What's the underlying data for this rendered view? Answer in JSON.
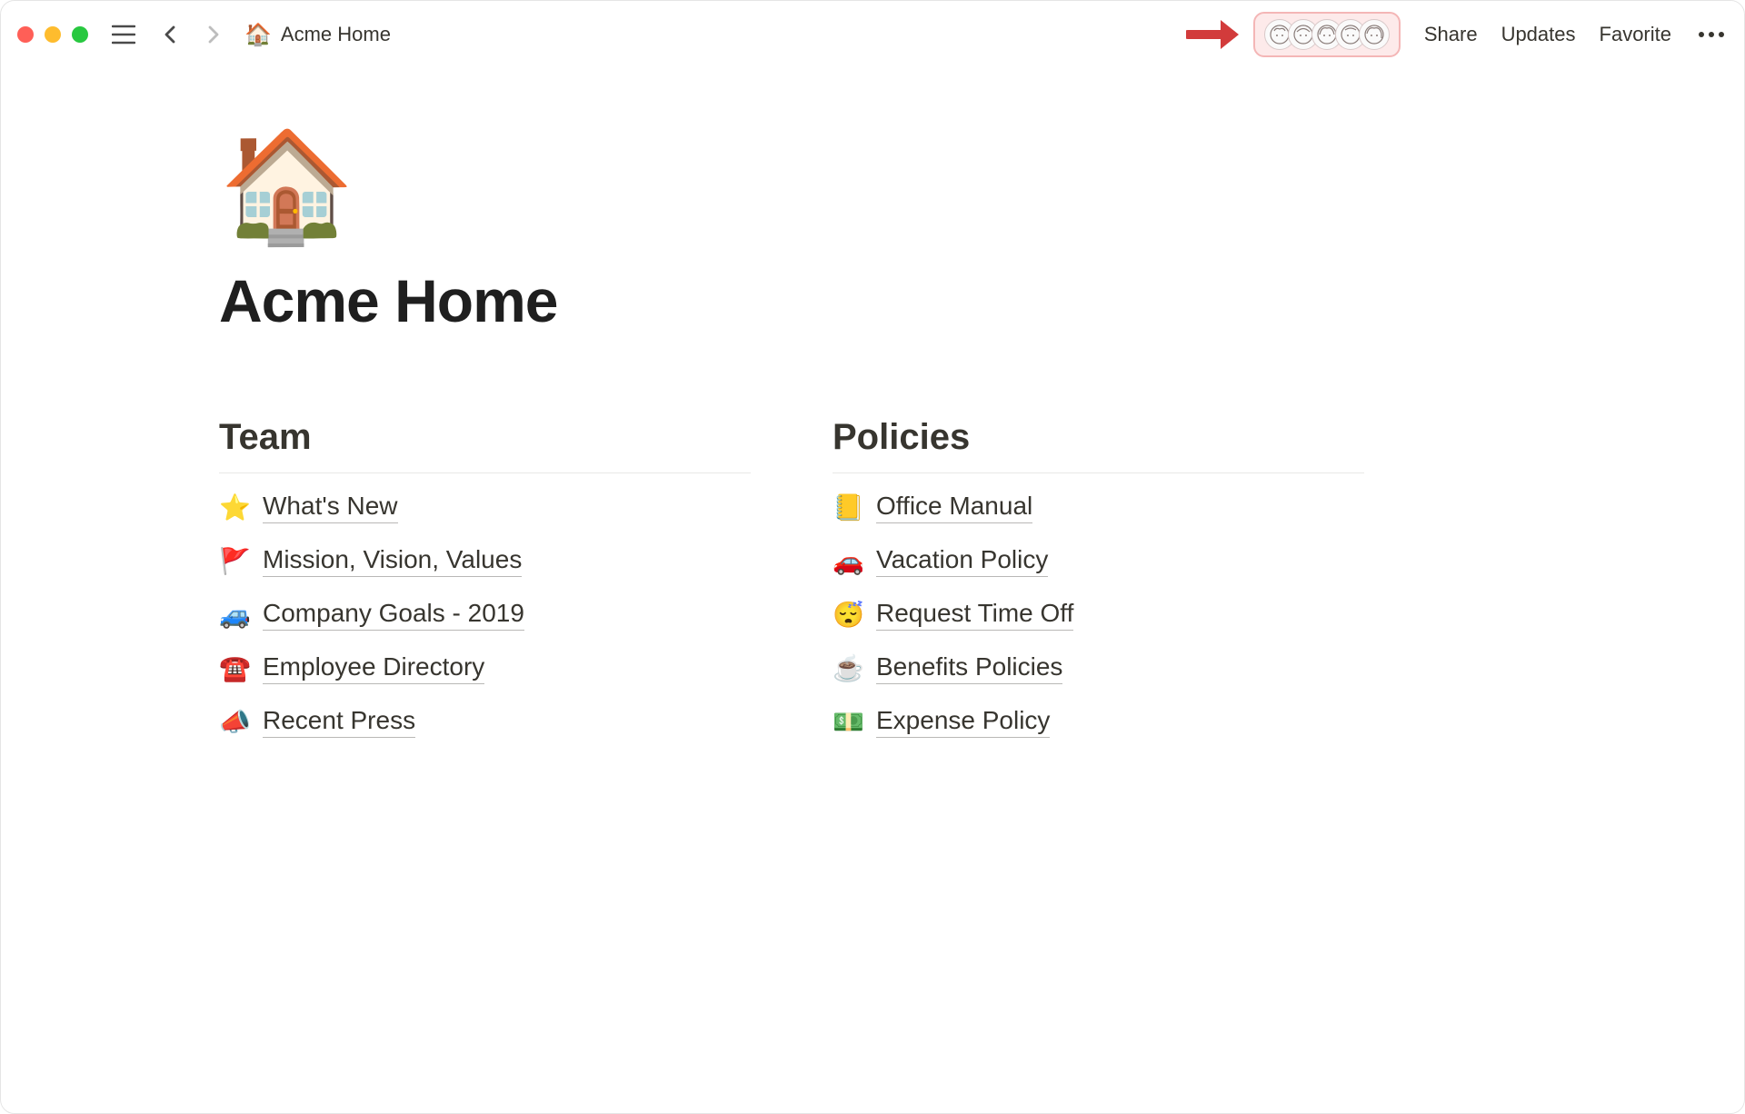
{
  "header": {
    "breadcrumb_icon": "🏠",
    "breadcrumb_title": "Acme Home",
    "share": "Share",
    "updates": "Updates",
    "favorite": "Favorite"
  },
  "presence": {
    "count": 5
  },
  "page": {
    "icon": "🏠",
    "title": "Acme Home"
  },
  "columns": [
    {
      "heading": "Team",
      "links": [
        {
          "icon": "⭐",
          "label": "What's New"
        },
        {
          "icon": "🚩",
          "label": "Mission, Vision, Values"
        },
        {
          "icon": "🚙",
          "label": "Company Goals - 2019"
        },
        {
          "icon": "☎️",
          "label": "Employee Directory"
        },
        {
          "icon": "📣",
          "label": "Recent Press"
        }
      ]
    },
    {
      "heading": "Policies",
      "links": [
        {
          "icon": "📒",
          "label": "Office Manual"
        },
        {
          "icon": "🚗",
          "label": "Vacation Policy"
        },
        {
          "icon": "😴",
          "label": "Request Time Off"
        },
        {
          "icon": "☕",
          "label": "Benefits Policies"
        },
        {
          "icon": "💵",
          "label": "Expense Policy"
        }
      ]
    }
  ]
}
